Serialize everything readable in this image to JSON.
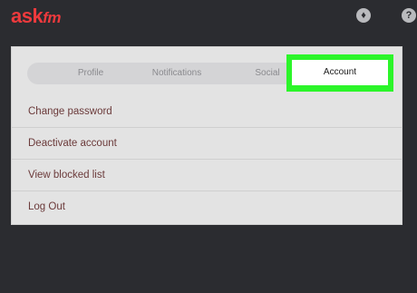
{
  "header": {
    "logo_main": "ask",
    "logo_suffix": "fm",
    "icons": [
      "gift-icon",
      "help-icon"
    ],
    "help_glyph": "?",
    "gift_glyph": "♦"
  },
  "tabs": {
    "profile": "Profile",
    "notifications": "Notifications",
    "social": "Social",
    "account": "Account"
  },
  "menu": {
    "items": [
      "Change password",
      "Deactivate account",
      "View blocked list",
      "Log Out"
    ]
  },
  "colors": {
    "background": "#2b2c30",
    "brand": "#ee3a3d",
    "highlight": "#2cf52a",
    "panel": "#e3e3e3"
  }
}
